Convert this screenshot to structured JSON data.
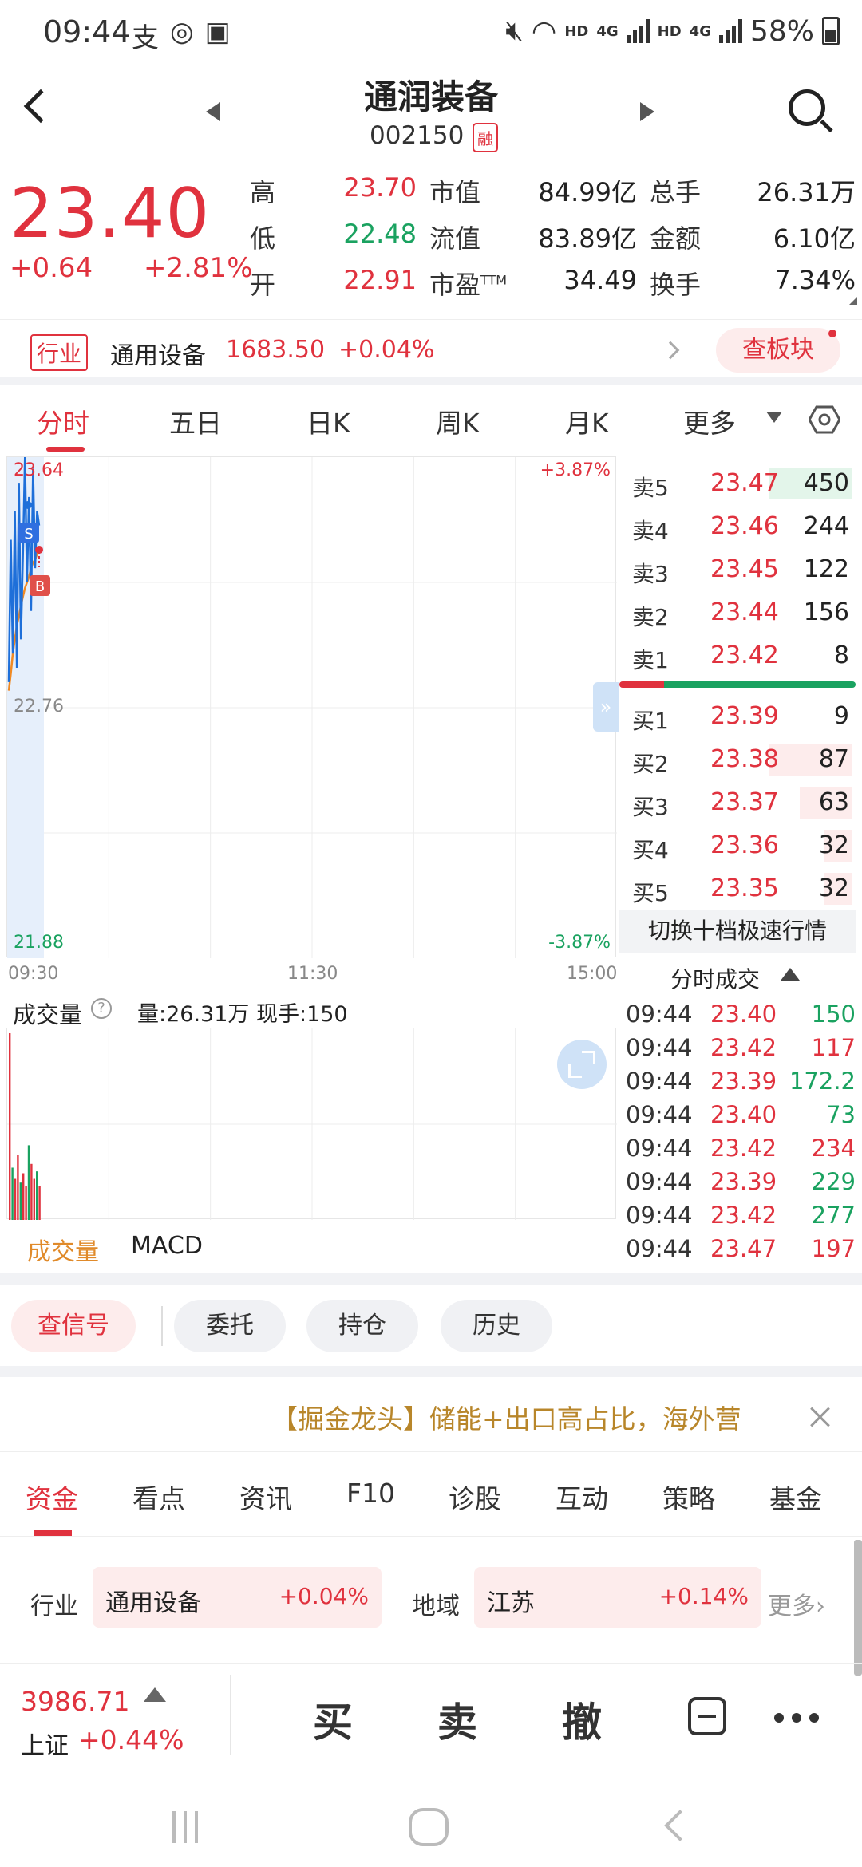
{
  "status_bar": {
    "time": "09:44",
    "battery": "58%",
    "hd1": "HD",
    "net1": "4G",
    "hd2": "HD",
    "net2": "4G"
  },
  "header": {
    "stock_name": "通润装备",
    "stock_code": "002150",
    "margin_badge": "融"
  },
  "quote": {
    "price": "23.40",
    "change": "+0.64",
    "change_pct": "+2.81%",
    "high_label": "高",
    "high": "23.70",
    "low_label": "低",
    "low": "22.48",
    "open_label": "开",
    "open": "22.91",
    "mktcap_label": "市值",
    "mktcap": "84.99亿",
    "float_label": "流值",
    "float_cap": "83.89亿",
    "pe_label": "市盈",
    "pe_sup": "TTM",
    "pe": "34.49",
    "volume_label": "总手",
    "volume": "26.31万",
    "amount_label": "金额",
    "amount": "6.10亿",
    "turnover_label": "换手",
    "turnover": "7.34%"
  },
  "industry": {
    "tag": "行业",
    "name": "通用设备",
    "index": "1683.50",
    "change": "+0.04%",
    "sector_button": "查板块"
  },
  "chart_tabs": {
    "intraday": "分时",
    "five_day": "五日",
    "daily_k": "日K",
    "weekly_k": "周K",
    "monthly_k": "月K",
    "more": "更多"
  },
  "chart_labels": {
    "high": "23.64",
    "high_pct": "+3.87%",
    "mid": "22.76",
    "low": "21.88",
    "low_pct": "-3.87%",
    "t_open": "09:30",
    "t_mid": "11:30",
    "t_close": "15:00",
    "sell_marker": "S",
    "buy_marker": "B",
    "collapse": "»"
  },
  "chart_data": {
    "type": "line",
    "ylim": [
      21.88,
      23.64
    ],
    "x_range": [
      "09:30",
      "15:00"
    ],
    "price": [
      22.85,
      23.35,
      22.95,
      23.45,
      22.9,
      23.55,
      23.0,
      23.3,
      23.64,
      23.2,
      23.5,
      23.1,
      23.6,
      23.25,
      23.45,
      23.4
    ],
    "avg": [
      22.82,
      22.88,
      22.95,
      23.0,
      23.05,
      23.08,
      23.12,
      23.15,
      23.18,
      23.2,
      23.22,
      23.25,
      23.27,
      23.28,
      23.3,
      23.31
    ],
    "volume_bars": [
      100,
      28,
      22,
      35,
      20,
      25,
      18,
      40,
      30,
      22,
      26,
      18
    ]
  },
  "order_book": {
    "asks": [
      {
        "label": "卖5",
        "price": "23.47",
        "volume": "450",
        "frac": 0.35
      },
      {
        "label": "卖4",
        "price": "23.46",
        "volume": "244",
        "frac": 0.0
      },
      {
        "label": "卖3",
        "price": "23.45",
        "volume": "122",
        "frac": 0.0
      },
      {
        "label": "卖2",
        "price": "23.44",
        "volume": "156",
        "frac": 0.0
      },
      {
        "label": "卖1",
        "price": "23.42",
        "volume": "8",
        "frac": 0.0
      }
    ],
    "bids": [
      {
        "label": "买1",
        "price": "23.39",
        "volume": "9",
        "frac": 0.0
      },
      {
        "label": "买2",
        "price": "23.38",
        "volume": "87",
        "frac": 0.35
      },
      {
        "label": "买3",
        "price": "23.37",
        "volume": "63",
        "frac": 0.22
      },
      {
        "label": "买4",
        "price": "23.36",
        "volume": "32",
        "frac": 0.12
      },
      {
        "label": "买5",
        "price": "23.35",
        "volume": "32",
        "frac": 0.12
      }
    ],
    "switch_label": "切换十档极速行情",
    "ticks_title": "分时成交"
  },
  "ticks": [
    {
      "time": "09:44",
      "price": "23.40",
      "vol": "150",
      "dir": "green"
    },
    {
      "time": "09:44",
      "price": "23.42",
      "vol": "117",
      "dir": "red"
    },
    {
      "time": "09:44",
      "price": "23.39",
      "vol": "172.2",
      "dir": "green"
    },
    {
      "time": "09:44",
      "price": "23.40",
      "vol": "73",
      "dir": "green"
    },
    {
      "time": "09:44",
      "price": "23.42",
      "vol": "234",
      "dir": "red"
    },
    {
      "time": "09:44",
      "price": "23.39",
      "vol": "229",
      "dir": "green"
    },
    {
      "time": "09:44",
      "price": "23.42",
      "vol": "277",
      "dir": "green"
    },
    {
      "time": "09:44",
      "price": "23.47",
      "vol": "197",
      "dir": "red"
    }
  ],
  "volume_panel": {
    "title": "成交量",
    "help": "?",
    "info": "量:26.31万 现手:150"
  },
  "indicator_tabs": {
    "volume": "成交量",
    "macd": "MACD"
  },
  "pills": {
    "signal": "查信号",
    "commission": "委托",
    "position": "持仓",
    "history": "历史"
  },
  "news": {
    "text": "【掘金龙头】储能+出口高占比，海外营"
  },
  "bottom_tabs": [
    "资金",
    "看点",
    "资讯",
    "F10",
    "诊股",
    "互动",
    "策略",
    "基金"
  ],
  "fund_row": {
    "industry_label": "行业",
    "industry_name": "通用设备",
    "industry_change": "+0.04%",
    "region_label": "地域",
    "region_name": "江苏",
    "region_change": "+0.14%",
    "more": "更多"
  },
  "trade_bar": {
    "index_value": "3986.71",
    "index_name": "上证",
    "index_change": "+0.44%",
    "buy": "买",
    "sell": "卖",
    "cancel": "撤"
  },
  "colors": {
    "up": "#e0323e",
    "down": "#1aa260",
    "price_line": "#1e6fd9",
    "avg_line": "#f08a24"
  }
}
